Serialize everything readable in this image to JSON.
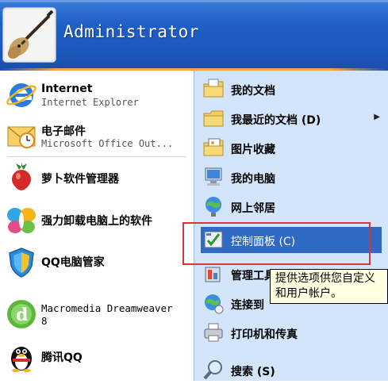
{
  "user": {
    "name": "Administrator"
  },
  "pinned": [
    {
      "title": "Internet",
      "subtitle": "Internet Explorer",
      "icon": "internet-explorer-icon"
    },
    {
      "title": "电子邮件",
      "subtitle": "Microsoft Office Out...",
      "icon": "outlook-mail-icon"
    }
  ],
  "recent": [
    {
      "title": "萝卜软件管理器",
      "icon": "radish-icon"
    },
    {
      "title": "强力卸载电脑上的软件",
      "icon": "butterfly-icon"
    },
    {
      "title": "QQ电脑管家",
      "icon": "qq-manager-shield-icon"
    },
    {
      "title": "Macromedia Dreamweaver",
      "title2": "8",
      "icon": "dreamweaver-icon"
    },
    {
      "title": "腾讯QQ",
      "icon": "qq-penguin-icon"
    }
  ],
  "places": [
    {
      "label": "我的文档",
      "icon": "my-documents-folder-icon"
    },
    {
      "label": "我最近的文档 (D)",
      "icon": "recent-documents-folder-icon",
      "submenu": true
    },
    {
      "label": "图片收藏",
      "icon": "my-pictures-folder-icon"
    },
    {
      "label": "我的电脑",
      "icon": "my-computer-icon"
    },
    {
      "label": "网上邻居",
      "icon": "network-places-icon"
    },
    {
      "label": "控制面板 (C)",
      "icon": "control-panel-icon",
      "selected": true
    },
    {
      "label": "管理工具",
      "icon": "admin-tools-icon"
    },
    {
      "label": "连接到",
      "icon": "connect-to-icon"
    },
    {
      "label": "打印机和传真",
      "icon": "printer-fax-icon"
    },
    {
      "label": "搜索 (S)",
      "icon": "search-icon"
    }
  ],
  "tooltip": {
    "line1": "提供选项供您自定义",
    "line2": "和用户帐户。"
  },
  "colors": {
    "header_blue": "#1f5fc7",
    "right_pane": "#d3e5fa",
    "highlight": "#316ac5",
    "annotation": "#d9333c"
  }
}
